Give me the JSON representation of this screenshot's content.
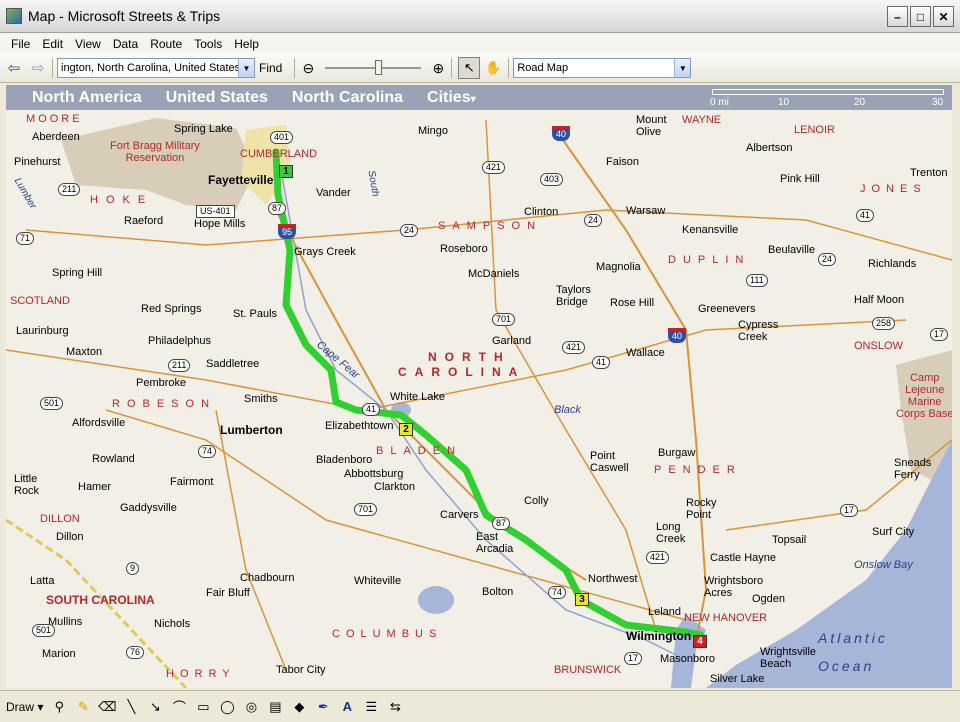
{
  "window": {
    "title": "Map - Microsoft Streets & Trips",
    "minimize": "–",
    "maximize": "□",
    "close": "✕"
  },
  "menu": [
    "File",
    "Edit",
    "View",
    "Data",
    "Route",
    "Tools",
    "Help"
  ],
  "toolbar": {
    "back_icon": "back-arrow-icon",
    "forward_icon": "forward-arrow-icon",
    "find_value": "ington, North Carolina, United States",
    "find_label": "Find",
    "zoom_level": 0.56,
    "map_style": "Road Map"
  },
  "navbar": {
    "crumbs": [
      "North America",
      "United States",
      "North Carolina",
      "Cities"
    ],
    "scale_labels": [
      "0 mi",
      "10",
      "20",
      "30"
    ]
  },
  "map": {
    "cities": [
      {
        "name": "Aberdeen"
      },
      {
        "name": "Spring Lake"
      },
      {
        "name": "Mingo"
      },
      {
        "name": "Mount\nOlive"
      },
      {
        "name": "Pinehurst"
      },
      {
        "name": "Faison"
      },
      {
        "name": "Albertson"
      },
      {
        "name": "Fayetteville",
        "big": true
      },
      {
        "name": "Vander"
      },
      {
        "name": "Pink Hill"
      },
      {
        "name": "Trenton"
      },
      {
        "name": "Raeford"
      },
      {
        "name": "Hope Mills"
      },
      {
        "name": "Clinton"
      },
      {
        "name": "Warsaw"
      },
      {
        "name": "Kenansville"
      },
      {
        "name": "Beulaville"
      },
      {
        "name": "Grays Creek"
      },
      {
        "name": "Roseboro"
      },
      {
        "name": "Richlands"
      },
      {
        "name": "Spring Hill"
      },
      {
        "name": "McDaniels"
      },
      {
        "name": "Magnolia"
      },
      {
        "name": "Half Moon"
      },
      {
        "name": "Red Springs"
      },
      {
        "name": "St. Pauls"
      },
      {
        "name": "Taylors\nBridge"
      },
      {
        "name": "Rose Hill"
      },
      {
        "name": "Greenevers"
      },
      {
        "name": "Laurinburg"
      },
      {
        "name": "Philadelphus"
      },
      {
        "name": "Cypress\nCreek"
      },
      {
        "name": "Maxton"
      },
      {
        "name": "Garland"
      },
      {
        "name": "Wallace"
      },
      {
        "name": "Saddletree"
      },
      {
        "name": "Pembroke"
      },
      {
        "name": "Smiths"
      },
      {
        "name": "White Lake"
      },
      {
        "name": "Alfordsville"
      },
      {
        "name": "Lumberton",
        "big": true
      },
      {
        "name": "Elizabethtown"
      },
      {
        "name": "Rowland"
      },
      {
        "name": "Bladenboro"
      },
      {
        "name": "Abbottsburg"
      },
      {
        "name": "Clarkton"
      },
      {
        "name": "Point\nCaswell"
      },
      {
        "name": "Burgaw"
      },
      {
        "name": "Sneads\nFerry"
      },
      {
        "name": "Fairmont"
      },
      {
        "name": "Little\nRock"
      },
      {
        "name": "Hamer"
      },
      {
        "name": "Gaddysville"
      },
      {
        "name": "Colly"
      },
      {
        "name": "Carvers"
      },
      {
        "name": "Rocky\nPoint"
      },
      {
        "name": "Surf City"
      },
      {
        "name": "Dillon"
      },
      {
        "name": "East\nArcadia"
      },
      {
        "name": "Long\nCreek"
      },
      {
        "name": "Topsail"
      },
      {
        "name": "Castle Hayne"
      },
      {
        "name": "Latta"
      },
      {
        "name": "Chadbourn"
      },
      {
        "name": "Whiteville"
      },
      {
        "name": "Northwest"
      },
      {
        "name": "Wrightsboro\nAcres"
      },
      {
        "name": "Fair Bluff"
      },
      {
        "name": "Bolton"
      },
      {
        "name": "Ogden"
      },
      {
        "name": "Mullins"
      },
      {
        "name": "Nichols"
      },
      {
        "name": "Leland"
      },
      {
        "name": "Wilmington",
        "big": true
      },
      {
        "name": "Wrightsville\nBeach"
      },
      {
        "name": "Marion"
      },
      {
        "name": "Tabor City"
      },
      {
        "name": "Masonboro"
      },
      {
        "name": "Silver Lake"
      }
    ],
    "counties": [
      {
        "name": "MOORE"
      },
      {
        "name": "CUMBERLAND"
      },
      {
        "name": "WAYNE"
      },
      {
        "name": "LENOIR"
      },
      {
        "name": "HOKE"
      },
      {
        "name": "JONES"
      },
      {
        "name": "SAMPSON"
      },
      {
        "name": "DUPLIN"
      },
      {
        "name": "SCOTLAND"
      },
      {
        "name": "ONSLOW"
      },
      {
        "name": "ROBESON"
      },
      {
        "name": "BLADEN"
      },
      {
        "name": "PENDER"
      },
      {
        "name": "DILLON"
      },
      {
        "name": "NEW HANOVER"
      },
      {
        "name": "HORRY"
      },
      {
        "name": "COLUMBUS"
      },
      {
        "name": "BRUNSWICK"
      }
    ],
    "regions": [
      {
        "name": "NORTH"
      },
      {
        "name": "CAROLINA"
      },
      {
        "name": "SOUTH CAROLINA"
      }
    ],
    "parks": [
      {
        "name": "Fort Bragg Military\nReservation"
      },
      {
        "name": "Camp\nLejeune\nMarine\nCorps Base"
      }
    ],
    "water": [
      {
        "name": "Cape Fear"
      },
      {
        "name": "Black"
      },
      {
        "name": "South"
      },
      {
        "name": "Lumber"
      },
      {
        "name": "Onslow Bay"
      }
    ],
    "ocean": [
      {
        "name": "Atlantic"
      },
      {
        "name": "Ocean"
      }
    ],
    "shields": [
      {
        "label": "401"
      },
      {
        "label": "87"
      },
      {
        "label": "211"
      },
      {
        "label": "421"
      },
      {
        "label": "403"
      },
      {
        "label": "24"
      },
      {
        "label": "24"
      },
      {
        "label": "41"
      },
      {
        "label": "24"
      },
      {
        "label": "71"
      },
      {
        "label": "111"
      },
      {
        "label": "258"
      },
      {
        "label": "17"
      },
      {
        "label": "701"
      },
      {
        "label": "421"
      },
      {
        "label": "211"
      },
      {
        "label": "41"
      },
      {
        "label": "41"
      },
      {
        "label": "501"
      },
      {
        "label": "74"
      },
      {
        "label": "701"
      },
      {
        "label": "87"
      },
      {
        "label": "421"
      },
      {
        "label": "17"
      },
      {
        "label": "9"
      },
      {
        "label": "74"
      },
      {
        "label": "501"
      },
      {
        "label": "76"
      },
      {
        "label": "17"
      },
      {
        "label": "US-401"
      }
    ],
    "interstates": [
      {
        "label": "40"
      },
      {
        "label": "95"
      },
      {
        "label": "40"
      }
    ],
    "stops": [
      {
        "label": "1",
        "color": "#3ec93e"
      },
      {
        "label": "2",
        "color": "#e6e63a"
      },
      {
        "label": "3",
        "color": "#e6e63a"
      },
      {
        "label": "4",
        "color": "#d62020"
      }
    ]
  },
  "drawbar": {
    "label": "Draw",
    "tools": [
      "pushpin-icon",
      "highlighter-icon",
      "eraser-icon",
      "line-icon",
      "arrow-icon",
      "freeform-icon",
      "rectangle-icon",
      "oval-icon",
      "radius-icon",
      "textbox-icon",
      "fill-color-icon",
      "line-color-icon",
      "font-color-icon",
      "line-style-icon",
      "arrow-style-icon"
    ]
  }
}
